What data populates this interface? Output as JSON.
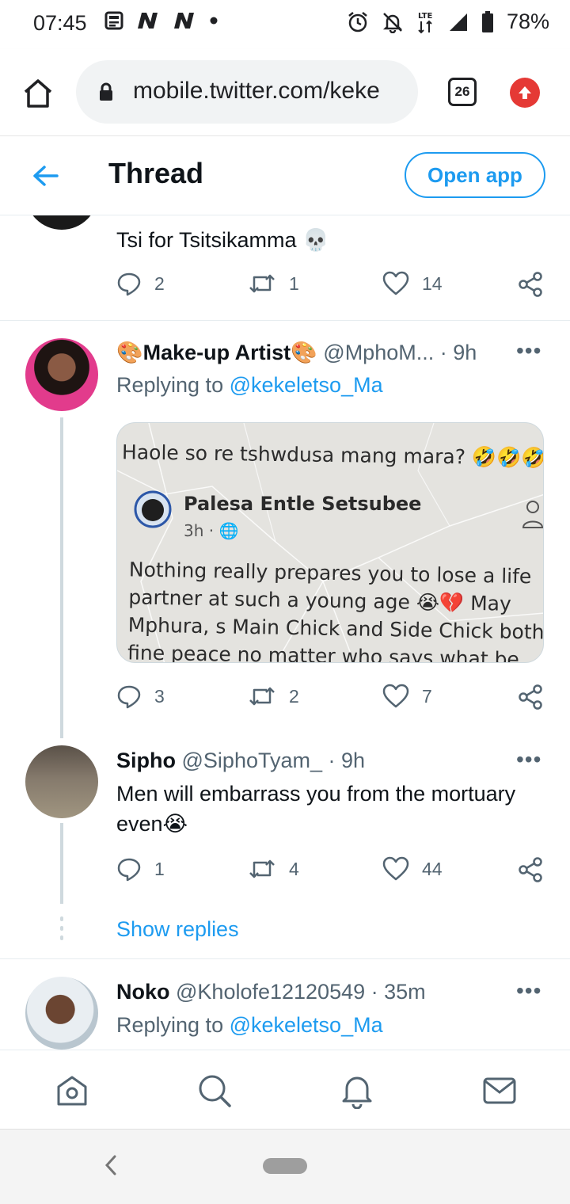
{
  "status_bar": {
    "time": "07:45",
    "battery": "78%",
    "network": "LTE",
    "icons_left": [
      "news-icon",
      "n-app-icon",
      "n-app-icon",
      "dot-icon"
    ],
    "icons_right": [
      "alarm-icon",
      "bell-off-icon",
      "lte-data-icon",
      "signal-icon",
      "battery-icon"
    ]
  },
  "browser": {
    "url": "mobile.twitter.com/keke",
    "tab_count": "26"
  },
  "header": {
    "title": "Thread",
    "open_app_label": "Open app"
  },
  "tweets": [
    {
      "text": "Tsi for Tsitsikamma 💀",
      "replies": "2",
      "retweets": "1",
      "likes": "14"
    },
    {
      "name": "🎨Make-up Artist🎨",
      "handle": "@MphoM...",
      "time": "· 9h",
      "replying_prefix": "Replying to ",
      "replying_handle": "@kekeletso_Ma",
      "media": {
        "caption": "Haole so re tshwdusa mang mara? 🤣🤣🤣",
        "poster": "Palesa Entle  Setsubee",
        "poster_time": "3h · 🌐",
        "body": "Nothing really prepares you to lose a life partner at such a young age 😭💔 May Mphura, s Main Chick and Side Chick both fine peace no matter who says what be..."
      },
      "replies": "3",
      "retweets": "2",
      "likes": "7"
    },
    {
      "name": "Sipho",
      "handle": "@SiphoTyam_",
      "time": "· 9h",
      "text": "Men will embarrass you from the mortuary even😭",
      "replies": "1",
      "retweets": "4",
      "likes": "44"
    },
    {
      "name": "Noko",
      "handle": "@Kholofe12120549",
      "time": "· 35m",
      "replying_prefix": "Replying to ",
      "replying_handle": "@kekeletso_Ma"
    }
  ],
  "show_replies_label": "Show replies",
  "more_label": "•••",
  "bottom_nav": [
    "home-icon",
    "search-icon",
    "notifications-icon",
    "messages-icon"
  ],
  "colors": {
    "accent": "#1d9bf0",
    "text": "#0f1419",
    "secondary": "#536471",
    "update_badge": "#e53935"
  }
}
